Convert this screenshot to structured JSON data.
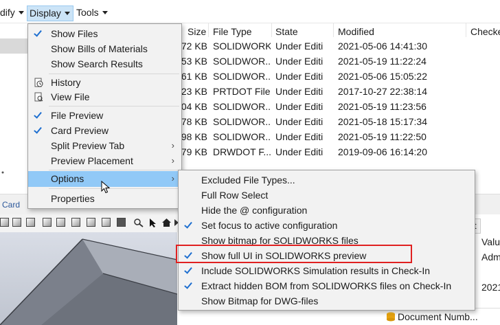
{
  "menubar": {
    "modify_label": "dify",
    "display_label": "Display",
    "tools_label": "Tools"
  },
  "filelist": {
    "columns": [
      "Size",
      "File Type",
      "State",
      "Modified",
      "Checke"
    ],
    "rows": [
      {
        "size": "72 KB",
        "type": "SOLIDWORKS",
        "state": "Under Editi",
        "modified": "2021-05-06 14:41:30"
      },
      {
        "size": "53 KB",
        "type": "SOLIDWOR...",
        "state": "Under Editi",
        "modified": "2021-05-19 11:22:24"
      },
      {
        "size": "61 KB",
        "type": "SOLIDWOR...",
        "state": "Under Editi",
        "modified": "2021-05-06 15:05:22"
      },
      {
        "size": "23 KB",
        "type": "PRTDOT File",
        "state": "Under Editi",
        "modified": "2017-10-27 22:38:14"
      },
      {
        "size": "04 KB",
        "type": "SOLIDWOR...",
        "state": "Under Editi",
        "modified": "2021-05-19 11:23:56"
      },
      {
        "size": "78 KB",
        "type": "SOLIDWOR...",
        "state": "Under Editi",
        "modified": "2021-05-18 15:17:34"
      },
      {
        "size": "98 KB",
        "type": "SOLIDWOR...",
        "state": "Under Editi",
        "modified": "2021-05-19 11:22:50"
      },
      {
        "size": "79 KB",
        "type": "DRWDOT F...",
        "state": "Under Editi",
        "modified": "2019-09-06 16:14:20"
      }
    ]
  },
  "display_menu": {
    "items": [
      {
        "label": "Show Files",
        "checked": true
      },
      {
        "label": "Show Bills of Materials",
        "checked": false
      },
      {
        "label": "Show Search Results",
        "checked": false
      },
      {
        "label": "History",
        "icon": "history-icon"
      },
      {
        "label": "View File",
        "icon": "view-file-icon"
      },
      {
        "label": "File Preview",
        "checked": true
      },
      {
        "label": "Card Preview",
        "checked": true
      },
      {
        "label": "Split Preview Tab",
        "submenu": true
      },
      {
        "label": "Preview Placement",
        "submenu": true
      },
      {
        "label": "Options",
        "submenu": true,
        "active": true
      },
      {
        "label": "Properties",
        "checked": false
      }
    ]
  },
  "options_menu": {
    "items": [
      {
        "label": "Excluded File Types...",
        "checked": false
      },
      {
        "label": "Full Row Select",
        "checked": false
      },
      {
        "label": "Hide the @ configuration",
        "checked": false
      },
      {
        "label": "Set focus to active configuration",
        "checked": true
      },
      {
        "label": "Show bitmap for SOLIDWORKS files",
        "checked": false
      },
      {
        "label": "Show full UI in SOLIDWORKS preview",
        "checked": true,
        "highlighted": true
      },
      {
        "label": "Include SOLIDWORKS Simulation results in Check-In",
        "checked": true
      },
      {
        "label": "Extract hidden BOM from SOLIDWORKS files on Check-In",
        "checked": true
      },
      {
        "label": "Show Bitmap for DWG-files",
        "checked": false
      }
    ]
  },
  "lower": {
    "card_tab": "Card",
    "right_col_header": "Valu",
    "right_val1": "Adm",
    "right_val2": "2021",
    "right_tab": "t",
    "doc_number": "Document Numb..."
  },
  "colors": {
    "accent": "#1e6fd0",
    "highlight_border": "#e02020",
    "active_item": "#91c9f7",
    "menu_bg": "#f2f2f2"
  }
}
